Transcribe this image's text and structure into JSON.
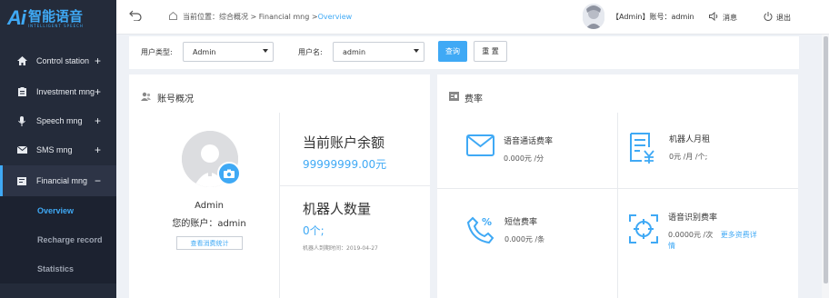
{
  "logo": {
    "mark": "Ai",
    "name": "智能语音",
    "tagline": "INTELLIGENT SPEECH"
  },
  "sidebar": {
    "items": [
      {
        "label": "Control station",
        "sign": "+"
      },
      {
        "label": "Investment mng",
        "sign": "+"
      },
      {
        "label": "Speech mng",
        "sign": "+"
      },
      {
        "label": "SMS mng",
        "sign": "+"
      },
      {
        "label": "Financial mng",
        "sign": "−"
      }
    ],
    "subitems": [
      {
        "label": "Overview"
      },
      {
        "label": "Recharge record"
      },
      {
        "label": "Statistics"
      }
    ]
  },
  "header": {
    "crumb_prefix": "当前位置：综合概况 > Financial mng > ",
    "crumb_current": "Overview",
    "user_text": "【Admin】账号：admin",
    "messages": "消息",
    "logout": "退出"
  },
  "filter": {
    "type_label": "用户类型:",
    "type_value": "Admin",
    "name_label": "用户名:",
    "name_value": "admin",
    "query_btn": "查询",
    "reset_btn": "重 置"
  },
  "account": {
    "title": "账号概况",
    "name": "Admin",
    "account": "您的账户：admin",
    "stats_link": "查看消费统计",
    "balance_title": "当前账户余额",
    "balance_value": "99999999.00元",
    "robots_title": "机器人数量",
    "robots_value": "0个;",
    "robots_expire": "机器人到期时间：2019-04-27"
  },
  "rates": {
    "title": "费率",
    "voice_title": "语音通话费率",
    "voice_value": "0.000元 /分",
    "robot_title": "机器人月租",
    "robot_value": "0元 /月 /个;",
    "sms_title": "短信费率",
    "sms_value": "0.000元 /条",
    "asr_title": "语音识别费率",
    "asr_value": "0.0000元 /次",
    "asr_more": "更多资费详情",
    "asr_more_tail": "情"
  },
  "colors": {
    "accent": "#3fa9f5",
    "sidebar": "#242b3a"
  }
}
